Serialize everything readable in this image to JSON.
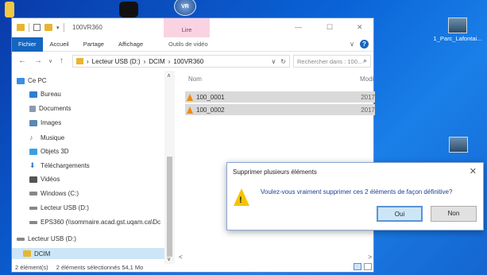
{
  "window": {
    "title": "100VR360",
    "tool_tab": "Lire",
    "controls": {
      "minimize": "—",
      "maximize": "☐",
      "close": "✕"
    }
  },
  "menu": {
    "file": "Fichier",
    "items": [
      "Accueil",
      "Partage",
      "Affichage"
    ],
    "context": "Outils de vidéo",
    "expand": "∨",
    "help": "?"
  },
  "address": {
    "back": "←",
    "forward": "→",
    "recent": "∨",
    "up": "↑",
    "path": [
      "Lecteur USB (D:)",
      "DCIM",
      "100VR360"
    ],
    "sep": "›",
    "dropdown": "∨",
    "refresh": "↻",
    "search_placeholder": "Rechercher dans : 100...",
    "search_icon": "⌕"
  },
  "nav": {
    "items": [
      {
        "label": "Ce PC",
        "icon": "computer-icon",
        "color": "#3a8ee6"
      },
      {
        "label": "Bureau",
        "icon": "desktop-icon",
        "color": "#2f7fd0"
      },
      {
        "label": "Documents",
        "icon": "document-icon",
        "color": "#8a9ab0"
      },
      {
        "label": "Images",
        "icon": "image-icon",
        "color": "#5b87b5"
      },
      {
        "label": "Musique",
        "icon": "music-icon",
        "color": "#2f7fd0"
      },
      {
        "label": "Objets 3D",
        "icon": "cube-icon",
        "color": "#3aa0e0"
      },
      {
        "label": "Téléchargements",
        "icon": "download-icon",
        "color": "#2f7fd0"
      },
      {
        "label": "Vidéos",
        "icon": "video-icon",
        "color": "#555"
      },
      {
        "label": "Windows (C:)",
        "icon": "drive-icon",
        "color": "#888"
      },
      {
        "label": "Lecteur USB (D:)",
        "icon": "usb-icon",
        "color": "#888"
      },
      {
        "label": "EPS360 (\\\\sommaire.acad.gst.uqam.ca\\Dc",
        "icon": "network-drive-icon",
        "color": "#888"
      },
      {
        "label": "Lecteur USB (D:)",
        "icon": "usb-icon",
        "color": "#888"
      },
      {
        "label": "DCIM",
        "icon": "folder-icon",
        "color": "#e8b530"
      }
    ],
    "scroll_up": "∧",
    "scroll_down": "∨"
  },
  "content": {
    "columns": {
      "name": "Nom",
      "modified": "Modi"
    },
    "files": [
      {
        "name": "100_0001",
        "date": "2017"
      },
      {
        "name": "100_0002",
        "date": "2017"
      }
    ],
    "hscroll_left": "<",
    "hscroll_right": ">"
  },
  "status": {
    "count": "2 élément(s)",
    "selection": "2 éléments sélectionnés  54,1 Mo"
  },
  "dialog": {
    "title": "Supprimer plusieurs éléments",
    "close": "✕",
    "message": "Voulez-vous vraiment supprimer ces 2 éléments de façon définitive?",
    "yes": "Oui",
    "no": "Non",
    "warn_mark": "!"
  },
  "desktop": {
    "icons": [
      {
        "label": "1_Parc_Lafontai..."
      }
    ]
  }
}
